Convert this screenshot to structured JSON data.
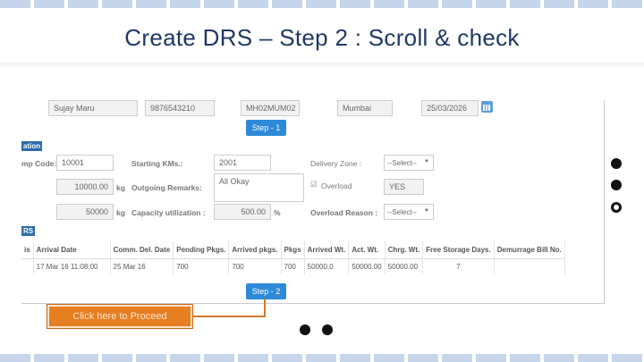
{
  "slide": {
    "title": "Create DRS – Step 2 : Scroll & check"
  },
  "row1": {
    "name": "Sujay Maru",
    "phone": "9876543210",
    "vehicle": "MH02MUM02",
    "city": "Mumbai",
    "date": "25/03/2026"
  },
  "step1": {
    "label": "Step - 1"
  },
  "section_station": {
    "label": "ation"
  },
  "form": {
    "emp_code_label": "mp Code:",
    "emp_code": "10001",
    "starting_kms_label": "Starting KMs.:",
    "starting_kms": "2001",
    "delivery_zone_label": "Delivery Zone :",
    "delivery_zone": "--Select--",
    "field_a_value": "10000.00",
    "field_a_unit": "kg",
    "outgoing_remarks_label": "Outgoing Remarks:",
    "outgoing_remarks": "All Okay",
    "overload_label": "Overload",
    "overload_value": "YES",
    "field_b_value": "50000",
    "field_b_unit": "kg",
    "capacity_label": "Capacity utilization :",
    "capacity_value": "500.00",
    "capacity_unit": "%",
    "overload_reason_label": "Overload Reason :",
    "overload_reason": "--Select--"
  },
  "section_drs": {
    "label": "RS"
  },
  "table": {
    "headers": [
      "is",
      "Arrival Date",
      "Comm. Del. Date",
      "Pending Pkgs.",
      "Arrived pkgs.",
      "Pkgs",
      "Arrived Wt.",
      "Act. Wt.",
      "Chrg. Wt.",
      "Free Storage Days.",
      "Demurrage Bill No."
    ],
    "rows": [
      [
        "",
        "17 Mar 16 11:08:00",
        "25 Mar 16",
        "700",
        "700",
        "700",
        "50000.0",
        "50000.00",
        "50000.00",
        "7",
        ""
      ]
    ]
  },
  "step2": {
    "label": "Step - 2"
  },
  "callout": {
    "label": "Click here to Proceed"
  },
  "colors": {
    "title": "#1f3864",
    "button": "#2e8ad8",
    "callout": "#e67e22",
    "section": "#2c6da8"
  }
}
